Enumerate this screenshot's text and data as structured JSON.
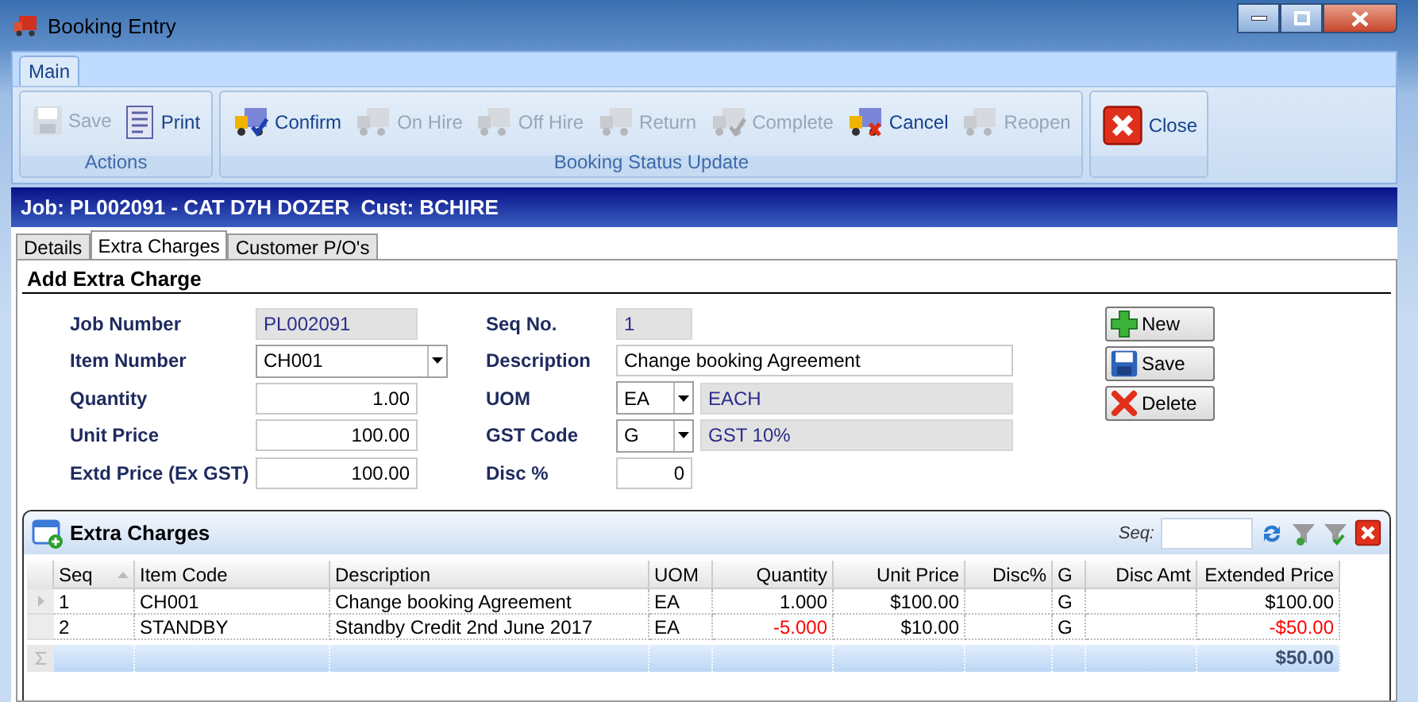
{
  "window": {
    "title": "Booking Entry"
  },
  "ribbon": {
    "tabs": [
      {
        "label": "Main",
        "selected": true
      }
    ],
    "groups": [
      {
        "label": "Actions",
        "buttons": [
          {
            "label": "Save",
            "disabled": true
          },
          {
            "label": "Print",
            "disabled": false
          }
        ]
      },
      {
        "label": "Booking Status Update",
        "buttons": [
          {
            "label": "Confirm",
            "disabled": false
          },
          {
            "label": "On Hire",
            "disabled": true
          },
          {
            "label": "Off Hire",
            "disabled": true
          },
          {
            "label": "Return",
            "disabled": true
          },
          {
            "label": "Complete",
            "disabled": true
          },
          {
            "label": "Cancel",
            "disabled": false
          },
          {
            "label": "Reopen",
            "disabled": true
          }
        ]
      },
      {
        "buttons": [
          {
            "label": "Close",
            "disabled": false
          }
        ]
      }
    ]
  },
  "job_header": "Job: PL002091 - CAT D7H DOZER  Cust: BCHIRE",
  "tabs": [
    {
      "label": "Details",
      "selected": false
    },
    {
      "label": "Extra Charges",
      "selected": true
    },
    {
      "label": "Customer P/O's",
      "selected": false
    }
  ],
  "form": {
    "title": "Add Extra Charge",
    "left": [
      {
        "label": "Job Number",
        "kind": "readonly",
        "value": "PL002091"
      },
      {
        "label": "Item Number",
        "kind": "combo",
        "value": "CH001"
      },
      {
        "label": "Quantity",
        "kind": "number",
        "value": "1.00"
      },
      {
        "label": "Unit Price",
        "kind": "number",
        "value": "100.00"
      },
      {
        "label": "Extd Price (Ex GST)",
        "kind": "number",
        "value": "100.00"
      }
    ],
    "right": [
      {
        "label": "Seq No.",
        "kind": "readonly",
        "value": "1"
      },
      {
        "label": "Description",
        "kind": "text",
        "value": "Change booking Agreement"
      },
      {
        "label": "UOM",
        "kind": "combo_desc",
        "value": "EA",
        "description": "EACH"
      },
      {
        "label": "GST Code",
        "kind": "combo_desc",
        "value": "G",
        "description": "GST 10%"
      },
      {
        "label": "Disc %",
        "kind": "number",
        "value": "0"
      }
    ],
    "buttons": [
      "New",
      "Save",
      "Delete"
    ]
  },
  "grid": {
    "title": "Extra Charges",
    "search_label": "Seq:",
    "columns": [
      {
        "label": "Seq",
        "kind": "text"
      },
      {
        "label": "Item Code",
        "kind": "text"
      },
      {
        "label": "Description",
        "kind": "text"
      },
      {
        "label": "UOM",
        "kind": "text"
      },
      {
        "label": "Quantity",
        "kind": "number"
      },
      {
        "label": "Unit Price",
        "kind": "number"
      },
      {
        "label": "Disc%",
        "kind": "number"
      },
      {
        "label": "G",
        "kind": "text"
      },
      {
        "label": "Disc Amt",
        "kind": "number"
      },
      {
        "label": "Extended Price",
        "kind": "number"
      }
    ],
    "rows": [
      {
        "current": true,
        "credit": false,
        "cells": [
          "1",
          "CH001",
          "Change booking Agreement",
          "EA",
          "1.000",
          "$100.00",
          "",
          "G",
          "",
          "$100.00"
        ]
      },
      {
        "current": false,
        "credit": true,
        "cells": [
          "2",
          "STANDBY",
          "Standby Credit 2nd June 2017",
          "EA",
          "-5.000",
          "$10.00",
          "",
          "G",
          "",
          "-$50.00"
        ]
      }
    ],
    "total": "$50.00"
  }
}
